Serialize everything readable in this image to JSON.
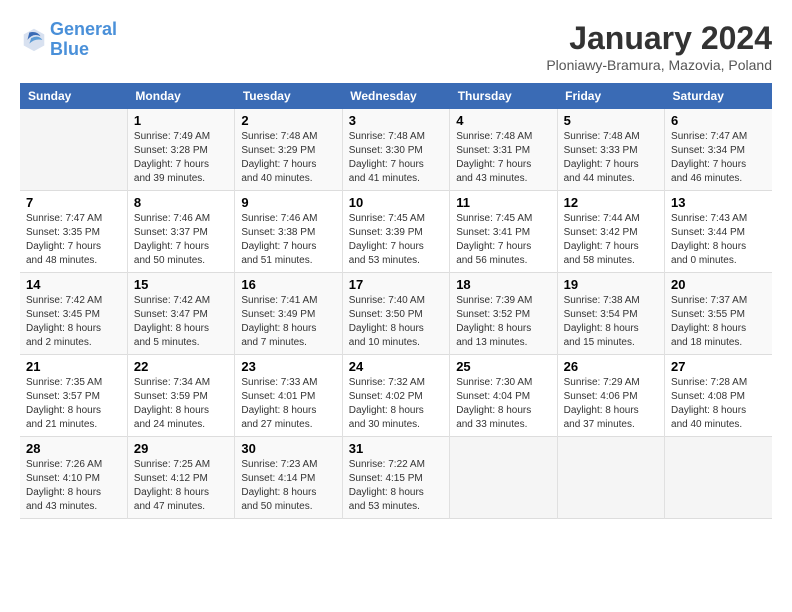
{
  "header": {
    "logo_line1": "General",
    "logo_line2": "Blue",
    "month_title": "January 2024",
    "location": "Ploniawy-Bramura, Mazovia, Poland"
  },
  "weekdays": [
    "Sunday",
    "Monday",
    "Tuesday",
    "Wednesday",
    "Thursday",
    "Friday",
    "Saturday"
  ],
  "weeks": [
    [
      {
        "day": "",
        "info": ""
      },
      {
        "day": "1",
        "info": "Sunrise: 7:49 AM\nSunset: 3:28 PM\nDaylight: 7 hours\nand 39 minutes."
      },
      {
        "day": "2",
        "info": "Sunrise: 7:48 AM\nSunset: 3:29 PM\nDaylight: 7 hours\nand 40 minutes."
      },
      {
        "day": "3",
        "info": "Sunrise: 7:48 AM\nSunset: 3:30 PM\nDaylight: 7 hours\nand 41 minutes."
      },
      {
        "day": "4",
        "info": "Sunrise: 7:48 AM\nSunset: 3:31 PM\nDaylight: 7 hours\nand 43 minutes."
      },
      {
        "day": "5",
        "info": "Sunrise: 7:48 AM\nSunset: 3:33 PM\nDaylight: 7 hours\nand 44 minutes."
      },
      {
        "day": "6",
        "info": "Sunrise: 7:47 AM\nSunset: 3:34 PM\nDaylight: 7 hours\nand 46 minutes."
      }
    ],
    [
      {
        "day": "7",
        "info": "Sunrise: 7:47 AM\nSunset: 3:35 PM\nDaylight: 7 hours\nand 48 minutes."
      },
      {
        "day": "8",
        "info": "Sunrise: 7:46 AM\nSunset: 3:37 PM\nDaylight: 7 hours\nand 50 minutes."
      },
      {
        "day": "9",
        "info": "Sunrise: 7:46 AM\nSunset: 3:38 PM\nDaylight: 7 hours\nand 51 minutes."
      },
      {
        "day": "10",
        "info": "Sunrise: 7:45 AM\nSunset: 3:39 PM\nDaylight: 7 hours\nand 53 minutes."
      },
      {
        "day": "11",
        "info": "Sunrise: 7:45 AM\nSunset: 3:41 PM\nDaylight: 7 hours\nand 56 minutes."
      },
      {
        "day": "12",
        "info": "Sunrise: 7:44 AM\nSunset: 3:42 PM\nDaylight: 7 hours\nand 58 minutes."
      },
      {
        "day": "13",
        "info": "Sunrise: 7:43 AM\nSunset: 3:44 PM\nDaylight: 8 hours\nand 0 minutes."
      }
    ],
    [
      {
        "day": "14",
        "info": "Sunrise: 7:42 AM\nSunset: 3:45 PM\nDaylight: 8 hours\nand 2 minutes."
      },
      {
        "day": "15",
        "info": "Sunrise: 7:42 AM\nSunset: 3:47 PM\nDaylight: 8 hours\nand 5 minutes."
      },
      {
        "day": "16",
        "info": "Sunrise: 7:41 AM\nSunset: 3:49 PM\nDaylight: 8 hours\nand 7 minutes."
      },
      {
        "day": "17",
        "info": "Sunrise: 7:40 AM\nSunset: 3:50 PM\nDaylight: 8 hours\nand 10 minutes."
      },
      {
        "day": "18",
        "info": "Sunrise: 7:39 AM\nSunset: 3:52 PM\nDaylight: 8 hours\nand 13 minutes."
      },
      {
        "day": "19",
        "info": "Sunrise: 7:38 AM\nSunset: 3:54 PM\nDaylight: 8 hours\nand 15 minutes."
      },
      {
        "day": "20",
        "info": "Sunrise: 7:37 AM\nSunset: 3:55 PM\nDaylight: 8 hours\nand 18 minutes."
      }
    ],
    [
      {
        "day": "21",
        "info": "Sunrise: 7:35 AM\nSunset: 3:57 PM\nDaylight: 8 hours\nand 21 minutes."
      },
      {
        "day": "22",
        "info": "Sunrise: 7:34 AM\nSunset: 3:59 PM\nDaylight: 8 hours\nand 24 minutes."
      },
      {
        "day": "23",
        "info": "Sunrise: 7:33 AM\nSunset: 4:01 PM\nDaylight: 8 hours\nand 27 minutes."
      },
      {
        "day": "24",
        "info": "Sunrise: 7:32 AM\nSunset: 4:02 PM\nDaylight: 8 hours\nand 30 minutes."
      },
      {
        "day": "25",
        "info": "Sunrise: 7:30 AM\nSunset: 4:04 PM\nDaylight: 8 hours\nand 33 minutes."
      },
      {
        "day": "26",
        "info": "Sunrise: 7:29 AM\nSunset: 4:06 PM\nDaylight: 8 hours\nand 37 minutes."
      },
      {
        "day": "27",
        "info": "Sunrise: 7:28 AM\nSunset: 4:08 PM\nDaylight: 8 hours\nand 40 minutes."
      }
    ],
    [
      {
        "day": "28",
        "info": "Sunrise: 7:26 AM\nSunset: 4:10 PM\nDaylight: 8 hours\nand 43 minutes."
      },
      {
        "day": "29",
        "info": "Sunrise: 7:25 AM\nSunset: 4:12 PM\nDaylight: 8 hours\nand 47 minutes."
      },
      {
        "day": "30",
        "info": "Sunrise: 7:23 AM\nSunset: 4:14 PM\nDaylight: 8 hours\nand 50 minutes."
      },
      {
        "day": "31",
        "info": "Sunrise: 7:22 AM\nSunset: 4:15 PM\nDaylight: 8 hours\nand 53 minutes."
      },
      {
        "day": "",
        "info": ""
      },
      {
        "day": "",
        "info": ""
      },
      {
        "day": "",
        "info": ""
      }
    ]
  ]
}
